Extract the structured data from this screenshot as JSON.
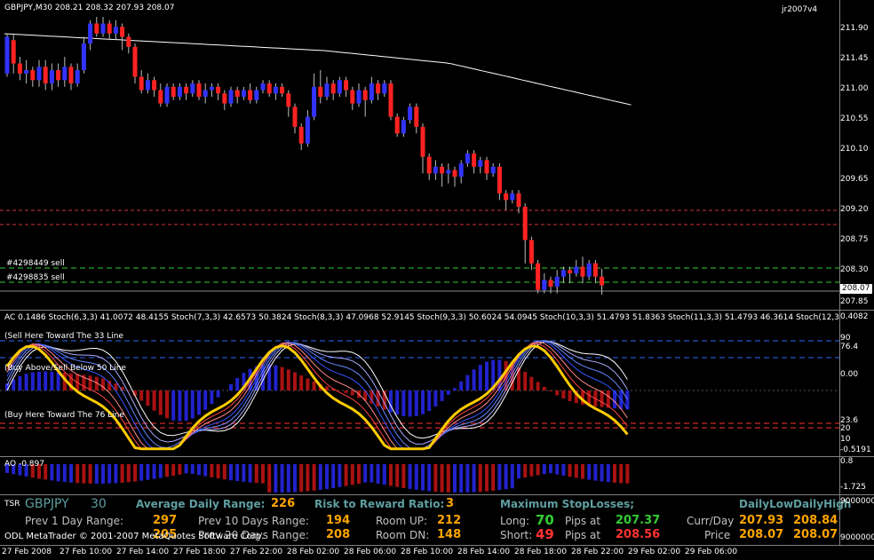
{
  "main": {
    "title": "GBPJPY,M30  208.21 208.32 207.93 208.07",
    "version": "jr2007v4",
    "price_axis": [
      "211.90",
      "211.45",
      "211.00",
      "210.55",
      "210.10",
      "209.65",
      "209.20",
      "208.75",
      "208.30",
      "207.85"
    ],
    "current_price": "208.07",
    "orders": [
      "#4298449 sell",
      "#4298835 sell"
    ]
  },
  "stoch": {
    "title": "AC 0.1486  Stoch(6,3,3) 41.0072 48.4155  Stoch(7,3,3) 42.6573 50.3824  Stoch(8,3,3) 47.0968 52.9145  Stoch(9,3,3) 50.6024 54.0945  Stoch(10,3,3) 51.4793 51.8363  Stoch(11,3,3) 51.4793 46.3614  Stoch(12,3,3) 42.8571 36.6",
    "label_sell": "(Sell Here Toward The 33 Line",
    "label_mid": "(Buy Above/Sell Below 50 Line",
    "label_buy": "(Buy Here Toward The 76 Line",
    "axis": [
      "0.4082",
      "90",
      "76.4",
      "0.00",
      "23.6",
      "10",
      "-0.5191"
    ],
    "axis_extra": "20"
  },
  "ao": {
    "title": "AO -0.897",
    "axis": [
      "0.8",
      "-1.725"
    ]
  },
  "info": {
    "tsr": "TSR",
    "symbol": "GBPJPY",
    "period": "30",
    "adr_label": "Average Daily Range:",
    "adr_value": "226",
    "rr_label": "Risk to Reward Ratio:",
    "rr_value": "3",
    "msl_label": "Maximum StopLosses;",
    "daily_low_hdr": "DailyLow",
    "daily_high_hdr": "DailyHigh",
    "prev1_label": "Prev 1 Day Range:",
    "prev1_value": "297",
    "prev10_label": "Prev 10 Days Range:",
    "prev10_value": "194",
    "prev20_label": "Prev 20 Days Range:",
    "prev20_value": "208",
    "prev5_value": "205",
    "room_up_label": "Room UP:",
    "room_up_value": "212",
    "room_dn_label": "Room DN:",
    "room_dn_value": "148",
    "long_label": "Long:",
    "long_value": "70",
    "short_label": "Short:",
    "short_value": "49",
    "pips_at_label": "Pips at",
    "long_pips": "207.37",
    "short_pips": "208.56",
    "currday_label": "Curr/Day",
    "price_label": "Price",
    "curr_low": "207.93",
    "curr_high": "208.84",
    "price_low": "208.07",
    "price_high": "208.07",
    "copyright": "ODL MetaTrader © 2001-2007 MetaQuotes Software Corp.",
    "axis_top": "9000000",
    "axis_bottom": "9000000"
  },
  "time_axis": [
    "27 Feb 2008",
    "27 Feb 10:00",
    "27 Feb 14:00",
    "27 Feb 18:00",
    "27 Feb 22:00",
    "28 Feb 02:00",
    "28 Feb 06:00",
    "28 Feb 10:00",
    "28 Feb 14:00",
    "28 Feb 18:00",
    "28 Feb 22:00",
    "29 Feb 02:00",
    "29 Feb 06:00"
  ],
  "colors": {
    "bull": "#3333ff",
    "bear": "#ff2222",
    "ma": "#ffffff",
    "yellow": "#ffcc00",
    "green": "#33cc33",
    "red_text": "#ff3333",
    "orange": "#ffa500",
    "teal": "#5f9ea0"
  },
  "candles": [
    [
      211.25,
      211.8,
      211.2,
      211.85
    ],
    [
      211.75,
      211.4,
      211.25,
      211.85
    ],
    [
      211.4,
      211.25,
      211.15,
      211.5
    ],
    [
      211.25,
      211.3,
      211.1,
      211.45
    ],
    [
      211.3,
      211.15,
      211.05,
      211.35
    ],
    [
      211.15,
      211.35,
      211.05,
      211.45
    ],
    [
      211.35,
      211.1,
      211.0,
      211.45
    ],
    [
      211.1,
      211.3,
      211.0,
      211.4
    ],
    [
      211.3,
      211.15,
      211.05,
      211.4
    ],
    [
      211.15,
      211.35,
      211.05,
      211.5
    ],
    [
      211.35,
      211.1,
      211.0,
      211.4
    ],
    [
      211.1,
      211.3,
      211.05,
      211.4
    ],
    [
      211.3,
      211.7,
      211.25,
      211.8
    ],
    [
      211.7,
      212.0,
      211.6,
      212.05
    ],
    [
      212.0,
      211.85,
      211.8,
      212.1
    ],
    [
      211.85,
      212.0,
      211.8,
      212.1
    ],
    [
      212.0,
      211.85,
      211.75,
      212.05
    ],
    [
      211.85,
      211.95,
      211.75,
      212.05
    ],
    [
      211.95,
      211.8,
      211.6,
      212.0
    ],
    [
      211.8,
      211.65,
      211.55,
      211.85
    ],
    [
      211.65,
      211.2,
      211.1,
      211.7
    ],
    [
      211.2,
      211.0,
      210.95,
      211.3
    ],
    [
      211.0,
      211.15,
      210.95,
      211.25
    ],
    [
      211.15,
      211.0,
      210.9,
      211.2
    ],
    [
      211.0,
      210.8,
      210.75,
      211.1
    ],
    [
      210.8,
      211.05,
      210.75,
      211.1
    ],
    [
      211.05,
      210.9,
      210.85,
      211.1
    ],
    [
      210.9,
      211.05,
      210.85,
      211.1
    ],
    [
      211.05,
      210.95,
      210.85,
      211.1
    ],
    [
      210.95,
      211.1,
      210.9,
      211.15
    ],
    [
      211.1,
      210.9,
      210.85,
      211.15
    ],
    [
      210.9,
      211.0,
      210.8,
      211.1
    ],
    [
      211.0,
      211.05,
      210.9,
      211.1
    ],
    [
      211.05,
      210.95,
      210.85,
      211.1
    ],
    [
      210.95,
      210.8,
      210.7,
      211.0
    ],
    [
      210.8,
      211.0,
      210.75,
      211.05
    ],
    [
      211.0,
      210.9,
      210.8,
      211.05
    ],
    [
      210.9,
      211.0,
      210.85,
      211.05
    ],
    [
      211.0,
      210.85,
      210.8,
      211.1
    ],
    [
      210.85,
      211.0,
      210.8,
      211.05
    ],
    [
      211.0,
      211.1,
      210.95,
      211.15
    ],
    [
      211.1,
      210.95,
      210.9,
      211.15
    ],
    [
      210.95,
      211.05,
      210.85,
      211.1
    ],
    [
      211.05,
      210.95,
      210.9,
      211.1
    ],
    [
      210.95,
      210.75,
      210.6,
      211.0
    ],
    [
      210.75,
      210.45,
      210.35,
      210.8
    ],
    [
      210.45,
      210.2,
      210.1,
      210.5
    ],
    [
      210.2,
      210.6,
      210.15,
      210.7
    ],
    [
      210.6,
      211.05,
      210.55,
      211.25
    ],
    [
      211.05,
      210.9,
      210.8,
      211.3
    ],
    [
      210.9,
      211.1,
      210.85,
      211.2
    ],
    [
      211.1,
      210.95,
      210.85,
      211.15
    ],
    [
      210.95,
      211.15,
      210.9,
      211.2
    ],
    [
      211.15,
      211.0,
      210.9,
      211.2
    ],
    [
      211.0,
      210.8,
      210.7,
      211.05
    ],
    [
      210.8,
      211.0,
      210.75,
      211.1
    ],
    [
      211.0,
      210.85,
      210.6,
      211.05
    ],
    [
      210.85,
      211.1,
      210.8,
      211.2
    ],
    [
      211.1,
      210.95,
      210.85,
      211.15
    ],
    [
      210.95,
      211.1,
      210.9,
      211.15
    ],
    [
      211.1,
      210.6,
      210.55,
      211.15
    ],
    [
      210.6,
      210.35,
      210.3,
      210.65
    ],
    [
      210.35,
      210.55,
      210.3,
      210.6
    ],
    [
      210.55,
      210.75,
      210.5,
      210.8
    ],
    [
      210.75,
      210.45,
      210.35,
      210.8
    ],
    [
      210.45,
      210.0,
      209.75,
      210.5
    ],
    [
      210.0,
      209.75,
      209.65,
      210.05
    ],
    [
      209.75,
      209.85,
      209.65,
      209.95
    ],
    [
      209.85,
      209.75,
      209.55,
      209.9
    ],
    [
      209.75,
      209.8,
      209.6,
      209.9
    ],
    [
      209.8,
      209.7,
      209.55,
      209.85
    ],
    [
      209.7,
      209.9,
      209.6,
      209.95
    ],
    [
      209.9,
      210.05,
      209.85,
      210.1
    ],
    [
      210.05,
      209.85,
      209.75,
      210.1
    ],
    [
      209.85,
      209.95,
      209.75,
      210.0
    ],
    [
      209.95,
      209.75,
      209.65,
      210.0
    ],
    [
      209.75,
      209.85,
      209.7,
      209.9
    ],
    [
      209.85,
      209.45,
      209.35,
      209.9
    ],
    [
      209.45,
      209.35,
      209.2,
      209.5
    ],
    [
      209.35,
      209.45,
      209.3,
      209.5
    ],
    [
      209.45,
      209.25,
      209.15,
      209.5
    ],
    [
      209.25,
      208.75,
      208.4,
      209.3
    ],
    [
      208.75,
      208.4,
      208.3,
      208.8
    ],
    [
      208.4,
      208.0,
      207.95,
      208.45
    ],
    [
      208.0,
      208.15,
      207.95,
      208.25
    ],
    [
      208.15,
      208.05,
      207.95,
      208.2
    ],
    [
      208.05,
      208.2,
      207.95,
      208.3
    ],
    [
      208.2,
      208.3,
      208.1,
      208.35
    ],
    [
      208.3,
      208.25,
      208.1,
      208.35
    ],
    [
      208.25,
      208.35,
      208.2,
      208.45
    ],
    [
      208.35,
      208.2,
      208.1,
      208.5
    ],
    [
      208.2,
      208.4,
      208.15,
      208.45
    ],
    [
      208.4,
      208.2,
      208.1,
      208.45
    ],
    [
      208.2,
      208.07,
      207.93,
      208.32
    ]
  ]
}
